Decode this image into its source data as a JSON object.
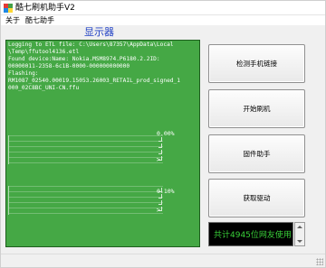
{
  "window": {
    "title": "酷七刷机助手V2",
    "icon": "app-logo-icon",
    "icon_colors": [
      "#e53935",
      "#43a047",
      "#1e88e5",
      "#fdd835"
    ]
  },
  "menu": [
    {
      "label": "关于"
    },
    {
      "label": "酷七助手"
    }
  ],
  "display": {
    "title": "显示器",
    "accent_color": "#1f3fc4",
    "background_color": "#45a845"
  },
  "log": {
    "lines": [
      "Logging to ETL file: C:\\Users\\87357\\AppData\\Local",
      "\\Temp\\ffutool4136.etl",
      "Found device:Name:     Nokia.MSM8974.P6180.2.2ID:",
      "00000011-2358-6c1B-0000-000000000000",
      "Flashing:",
      "RM1087_02540.00019.15053.26003_RETAIL_prod_signed_1",
      "000_02C8BC_UNI-CN.ffu"
    ]
  },
  "progress": [
    {
      "value": 0.0,
      "label": "0.00%"
    },
    {
      "value": 0.001,
      "label": "0.10%"
    }
  ],
  "buttons": {
    "detect": "检测手机链接",
    "start_flash": "开始刷机",
    "firmware": "固件助手",
    "get_driver": "获取驱动"
  },
  "info": {
    "text": "共计4945位网友使用",
    "text_color": "#39d039"
  }
}
